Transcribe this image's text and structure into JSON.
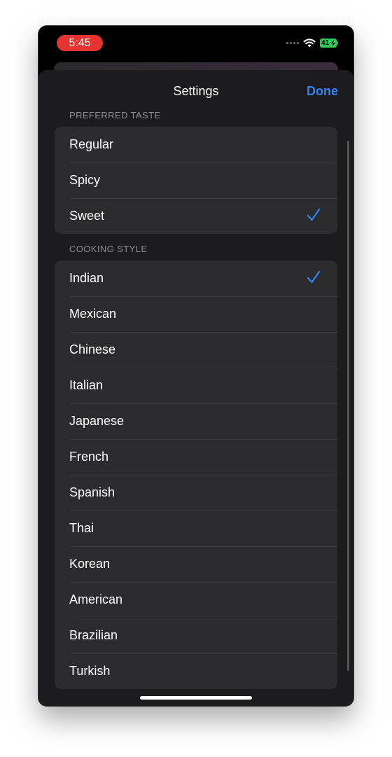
{
  "status": {
    "time": "5:45",
    "battery": "41"
  },
  "header": {
    "title": "Settings",
    "done_label": "Done"
  },
  "preferred_taste": {
    "header": "PREFERRED TASTE",
    "options": [
      "Regular",
      "Spicy",
      "Sweet"
    ],
    "selected": "Sweet"
  },
  "cooking_style": {
    "header": "COOKING STYLE",
    "options": [
      "Indian",
      "Mexican",
      "Chinese",
      "Italian",
      "Japanese",
      "French",
      "Spanish",
      "Thai",
      "Korean",
      "American",
      "Brazilian",
      "Turkish"
    ],
    "selected": "Indian"
  },
  "colors": {
    "accent": "#2f84f5",
    "background": "#1c1c1e",
    "cell": "#2c2c2e",
    "time_pill": "#e5342f"
  }
}
